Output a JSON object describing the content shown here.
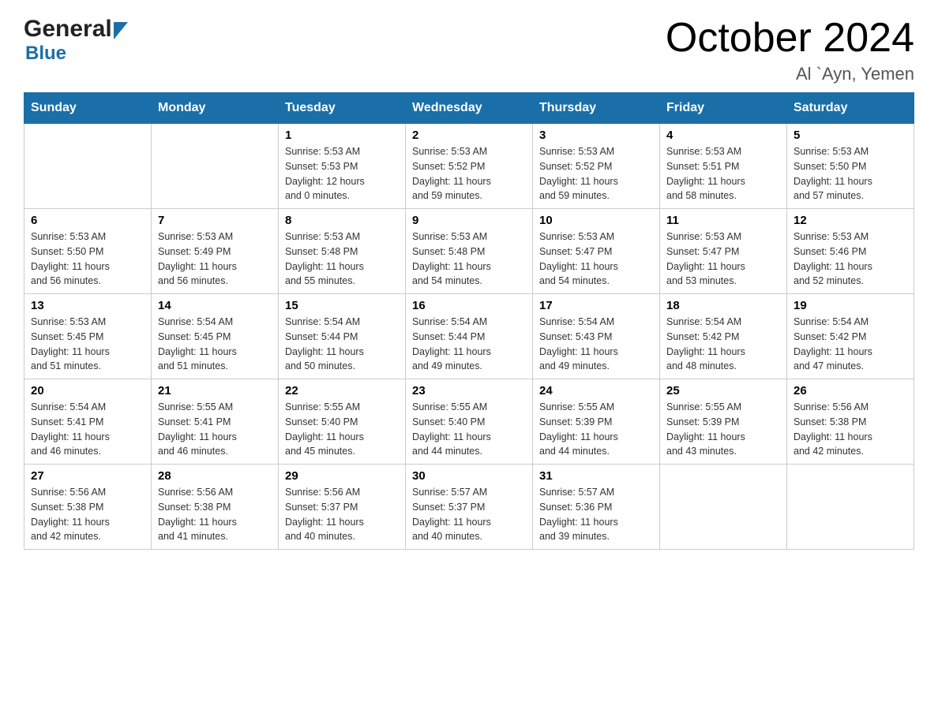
{
  "header": {
    "title": "October 2024",
    "location": "Al `Ayn, Yemen",
    "logo_general": "General",
    "logo_blue": "Blue"
  },
  "calendar": {
    "days_of_week": [
      "Sunday",
      "Monday",
      "Tuesday",
      "Wednesday",
      "Thursday",
      "Friday",
      "Saturday"
    ],
    "weeks": [
      [
        {
          "day": "",
          "info": ""
        },
        {
          "day": "",
          "info": ""
        },
        {
          "day": "1",
          "info": "Sunrise: 5:53 AM\nSunset: 5:53 PM\nDaylight: 12 hours\nand 0 minutes."
        },
        {
          "day": "2",
          "info": "Sunrise: 5:53 AM\nSunset: 5:52 PM\nDaylight: 11 hours\nand 59 minutes."
        },
        {
          "day": "3",
          "info": "Sunrise: 5:53 AM\nSunset: 5:52 PM\nDaylight: 11 hours\nand 59 minutes."
        },
        {
          "day": "4",
          "info": "Sunrise: 5:53 AM\nSunset: 5:51 PM\nDaylight: 11 hours\nand 58 minutes."
        },
        {
          "day": "5",
          "info": "Sunrise: 5:53 AM\nSunset: 5:50 PM\nDaylight: 11 hours\nand 57 minutes."
        }
      ],
      [
        {
          "day": "6",
          "info": "Sunrise: 5:53 AM\nSunset: 5:50 PM\nDaylight: 11 hours\nand 56 minutes."
        },
        {
          "day": "7",
          "info": "Sunrise: 5:53 AM\nSunset: 5:49 PM\nDaylight: 11 hours\nand 56 minutes."
        },
        {
          "day": "8",
          "info": "Sunrise: 5:53 AM\nSunset: 5:48 PM\nDaylight: 11 hours\nand 55 minutes."
        },
        {
          "day": "9",
          "info": "Sunrise: 5:53 AM\nSunset: 5:48 PM\nDaylight: 11 hours\nand 54 minutes."
        },
        {
          "day": "10",
          "info": "Sunrise: 5:53 AM\nSunset: 5:47 PM\nDaylight: 11 hours\nand 54 minutes."
        },
        {
          "day": "11",
          "info": "Sunrise: 5:53 AM\nSunset: 5:47 PM\nDaylight: 11 hours\nand 53 minutes."
        },
        {
          "day": "12",
          "info": "Sunrise: 5:53 AM\nSunset: 5:46 PM\nDaylight: 11 hours\nand 52 minutes."
        }
      ],
      [
        {
          "day": "13",
          "info": "Sunrise: 5:53 AM\nSunset: 5:45 PM\nDaylight: 11 hours\nand 51 minutes."
        },
        {
          "day": "14",
          "info": "Sunrise: 5:54 AM\nSunset: 5:45 PM\nDaylight: 11 hours\nand 51 minutes."
        },
        {
          "day": "15",
          "info": "Sunrise: 5:54 AM\nSunset: 5:44 PM\nDaylight: 11 hours\nand 50 minutes."
        },
        {
          "day": "16",
          "info": "Sunrise: 5:54 AM\nSunset: 5:44 PM\nDaylight: 11 hours\nand 49 minutes."
        },
        {
          "day": "17",
          "info": "Sunrise: 5:54 AM\nSunset: 5:43 PM\nDaylight: 11 hours\nand 49 minutes."
        },
        {
          "day": "18",
          "info": "Sunrise: 5:54 AM\nSunset: 5:42 PM\nDaylight: 11 hours\nand 48 minutes."
        },
        {
          "day": "19",
          "info": "Sunrise: 5:54 AM\nSunset: 5:42 PM\nDaylight: 11 hours\nand 47 minutes."
        }
      ],
      [
        {
          "day": "20",
          "info": "Sunrise: 5:54 AM\nSunset: 5:41 PM\nDaylight: 11 hours\nand 46 minutes."
        },
        {
          "day": "21",
          "info": "Sunrise: 5:55 AM\nSunset: 5:41 PM\nDaylight: 11 hours\nand 46 minutes."
        },
        {
          "day": "22",
          "info": "Sunrise: 5:55 AM\nSunset: 5:40 PM\nDaylight: 11 hours\nand 45 minutes."
        },
        {
          "day": "23",
          "info": "Sunrise: 5:55 AM\nSunset: 5:40 PM\nDaylight: 11 hours\nand 44 minutes."
        },
        {
          "day": "24",
          "info": "Sunrise: 5:55 AM\nSunset: 5:39 PM\nDaylight: 11 hours\nand 44 minutes."
        },
        {
          "day": "25",
          "info": "Sunrise: 5:55 AM\nSunset: 5:39 PM\nDaylight: 11 hours\nand 43 minutes."
        },
        {
          "day": "26",
          "info": "Sunrise: 5:56 AM\nSunset: 5:38 PM\nDaylight: 11 hours\nand 42 minutes."
        }
      ],
      [
        {
          "day": "27",
          "info": "Sunrise: 5:56 AM\nSunset: 5:38 PM\nDaylight: 11 hours\nand 42 minutes."
        },
        {
          "day": "28",
          "info": "Sunrise: 5:56 AM\nSunset: 5:38 PM\nDaylight: 11 hours\nand 41 minutes."
        },
        {
          "day": "29",
          "info": "Sunrise: 5:56 AM\nSunset: 5:37 PM\nDaylight: 11 hours\nand 40 minutes."
        },
        {
          "day": "30",
          "info": "Sunrise: 5:57 AM\nSunset: 5:37 PM\nDaylight: 11 hours\nand 40 minutes."
        },
        {
          "day": "31",
          "info": "Sunrise: 5:57 AM\nSunset: 5:36 PM\nDaylight: 11 hours\nand 39 minutes."
        },
        {
          "day": "",
          "info": ""
        },
        {
          "day": "",
          "info": ""
        }
      ]
    ]
  }
}
